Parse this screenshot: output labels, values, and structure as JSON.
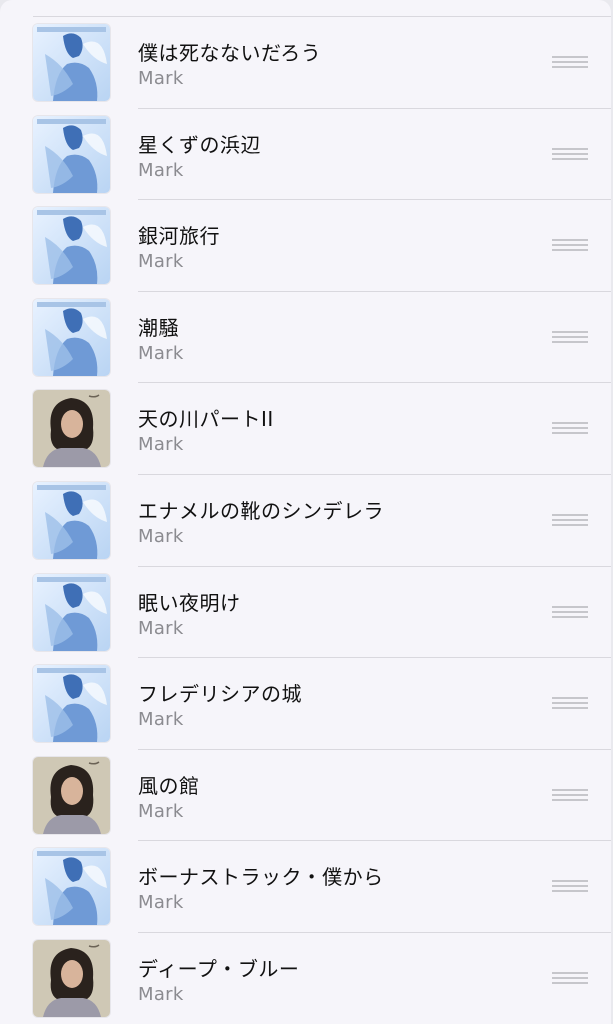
{
  "tracks": [
    {
      "title": "僕は死なないだろう",
      "artist": "Mark",
      "artwork": "blue"
    },
    {
      "title": "星くずの浜辺",
      "artist": "Mark",
      "artwork": "blue"
    },
    {
      "title": "銀河旅行",
      "artist": "Mark",
      "artwork": "blue"
    },
    {
      "title": "潮騒",
      "artist": "Mark",
      "artwork": "blue"
    },
    {
      "title": "天の川パートII",
      "artist": "Mark",
      "artwork": "portrait"
    },
    {
      "title": "エナメルの靴のシンデレラ",
      "artist": "Mark",
      "artwork": "blue"
    },
    {
      "title": "眠い夜明け",
      "artist": "Mark",
      "artwork": "blue"
    },
    {
      "title": "フレデリシアの城",
      "artist": "Mark",
      "artwork": "blue"
    },
    {
      "title": "風の館",
      "artist": "Mark",
      "artwork": "portrait"
    },
    {
      "title": "ボーナストラック・僕から",
      "artist": "Mark",
      "artwork": "blue"
    },
    {
      "title": "ディープ・ブルー",
      "artist": "Mark",
      "artwork": "portrait"
    }
  ]
}
